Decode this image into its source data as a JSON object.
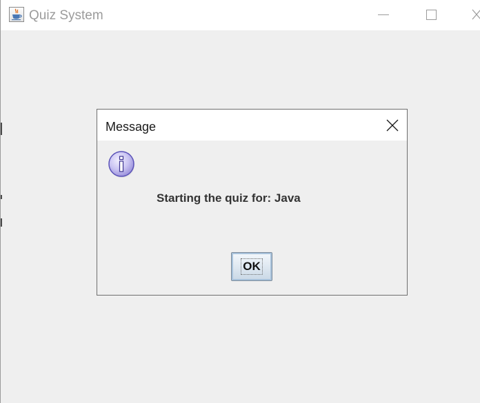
{
  "window": {
    "title": "Quiz System",
    "app_icon": "java-coffee-cup-icon",
    "controls": [
      "minimize-icon",
      "maximize-icon",
      "close-icon"
    ]
  },
  "dialog": {
    "title": "Message",
    "icon": "information-icon",
    "message": "Starting the quiz for: Java",
    "ok_label": "OK",
    "close_icon": "close-icon"
  },
  "colors": {
    "window_background": "#efefef",
    "title_bar": "#ffffff",
    "window_title_text": "#9b9b9b",
    "dialog_border": "#6d6d6d",
    "info_icon_fill": "#c9c3f2",
    "info_icon_stroke": "#5a52b8",
    "ok_button_top": "#f4f8fc",
    "ok_button_bottom": "#c9d8e6"
  }
}
